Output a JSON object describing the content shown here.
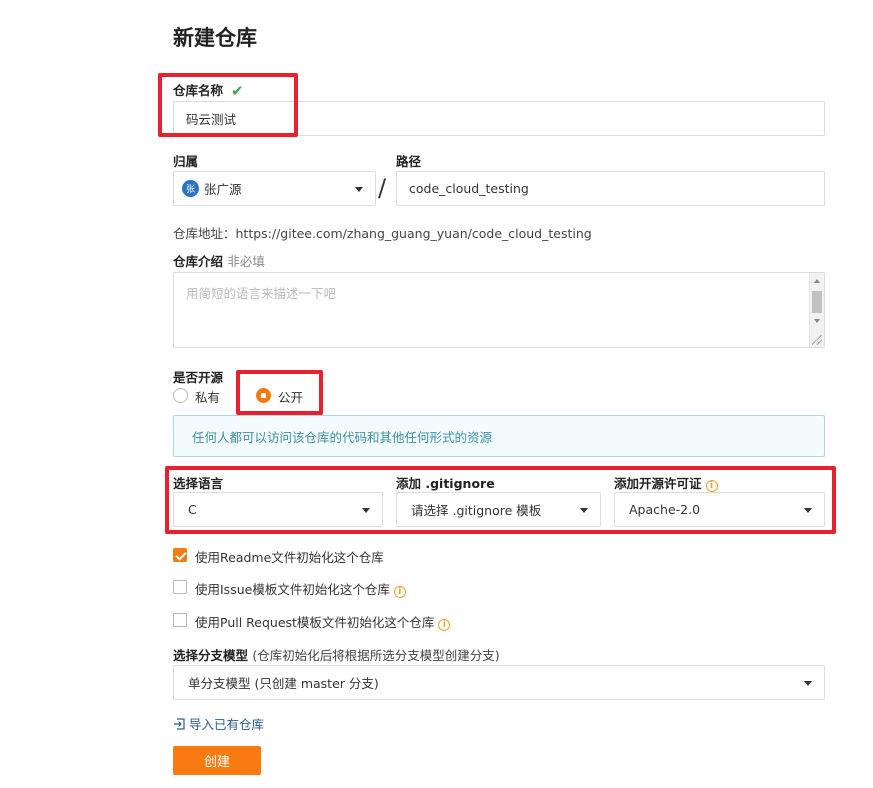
{
  "page": {
    "title": "新建仓库"
  },
  "repo_name": {
    "label": "仓库名称",
    "value": "码云测试",
    "valid_icon": "check-icon"
  },
  "owner": {
    "label": "归属",
    "avatar_text": "张",
    "value": "张广源"
  },
  "path": {
    "label": "路径",
    "separator": "/",
    "value": "code_cloud_testing"
  },
  "repo_address": {
    "text": "仓库地址：https://gitee.com/zhang_guang_yuan/code_cloud_testing"
  },
  "description": {
    "label": "仓库介绍",
    "optional": "非必填",
    "placeholder": "用简短的语言来描述一下吧"
  },
  "visibility": {
    "label": "是否开源",
    "options": [
      {
        "label": "私有",
        "selected": false
      },
      {
        "label": "公开",
        "selected": true
      }
    ],
    "notice": "任何人都可以访问该仓库的代码和其他任何形式的资源"
  },
  "language": {
    "label": "选择语言",
    "value": "C"
  },
  "gitignore": {
    "label": "添加 .gitignore",
    "value": "请选择 .gitignore 模板"
  },
  "license": {
    "label": "添加开源许可证",
    "value": "Apache-2.0"
  },
  "init_options": [
    {
      "label": "使用Readme文件初始化这个仓库",
      "checked": true
    },
    {
      "label": "使用Issue模板文件初始化这个仓库",
      "checked": false
    },
    {
      "label": "使用Pull Request模板文件初始化这个仓库",
      "checked": false
    }
  ],
  "branch_model": {
    "label": "选择分支模型",
    "hint": "(仓库初始化后将根据所选分支模型创建分支)",
    "value": "单分支模型 (只创建 master 分支)"
  },
  "import_link": "导入已有仓库",
  "submit_label": "创建",
  "colors": {
    "accent": "#fa7a12",
    "highlight": "#e8202f",
    "info": "#3c8fa8",
    "valid": "#3aa844"
  }
}
